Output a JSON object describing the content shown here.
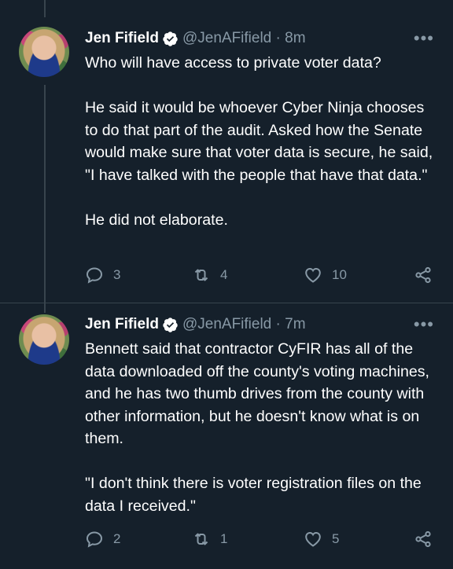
{
  "tweets": [
    {
      "name": "Jen Fifield",
      "handle": "@JenAFifield",
      "time": "8m",
      "paragraphs": [
        "Who will have access to private voter data?",
        "He said it would be whoever Cyber Ninja chooses to do that part of the audit. Asked how the Senate would make sure that voter data is secure, he said, \"I have talked with the people that have that data.\"",
        "He did not elaborate."
      ],
      "replies": "3",
      "retweets": "4",
      "likes": "10"
    },
    {
      "name": "Jen Fifield",
      "handle": "@JenAFifield",
      "time": "7m",
      "paragraphs": [
        "Bennett said that contractor CyFIR has all of the data downloaded off the county's voting machines, and he has two thumb drives from the county with other information, but he doesn't know what is on them.",
        "\"I don't think there is voter registration files on the data I received.\""
      ],
      "replies": "2",
      "retweets": "1",
      "likes": "5"
    }
  ],
  "separator": " · ",
  "more_label": "•••",
  "icons": {
    "verified": "verified-badge-icon",
    "reply": "reply-icon",
    "retweet": "retweet-icon",
    "like": "heart-icon",
    "share": "share-icon"
  },
  "colors": {
    "background": "#15202b",
    "text": "#ffffff",
    "secondary": "#8899a6",
    "divider": "#38444d"
  }
}
